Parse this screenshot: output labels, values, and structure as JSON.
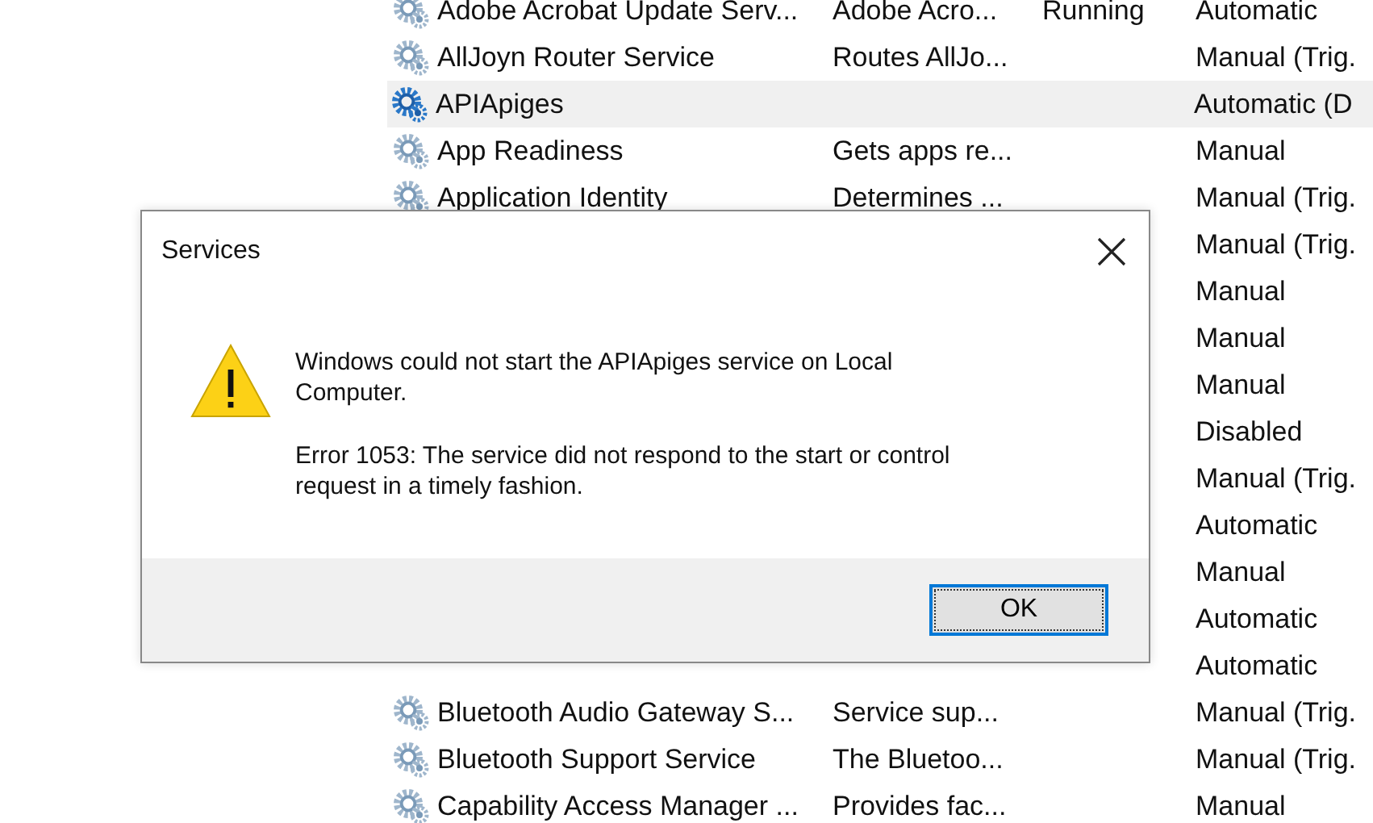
{
  "services": {
    "rows": [
      {
        "name": "Adobe Acrobat Update Serv...",
        "description": "Adobe Acro...",
        "status": "Running",
        "startup": "Automatic",
        "selected": false
      },
      {
        "name": "AllJoyn Router Service",
        "description": "Routes AllJo...",
        "startup": "Manual (Trig.",
        "selected": false
      },
      {
        "name": "APIApiges",
        "startup": "Automatic (D",
        "selected": true
      },
      {
        "name": "App Readiness",
        "description": "Gets apps re...",
        "startup": "Manual",
        "selected": false
      },
      {
        "name": "Application Identity",
        "description": "Determines ...",
        "startup": "Manual (Trig.",
        "selected": false
      },
      {
        "startup": "Manual (Trig.",
        "selected": false
      },
      {
        "startup": "Manual",
        "selected": false
      },
      {
        "startup": "Manual",
        "selected": false
      },
      {
        "startup": "Manual",
        "selected": false
      },
      {
        "startup": "Disabled",
        "selected": false
      },
      {
        "startup": "Manual (Trig.",
        "selected": false
      },
      {
        "startup": "Automatic",
        "selected": false
      },
      {
        "startup": "Manual",
        "selected": false
      },
      {
        "startup": "Automatic",
        "selected": false
      },
      {
        "startup": "Automatic",
        "selected": false
      },
      {
        "name": "Bluetooth Audio Gateway S...",
        "description": "Service sup...",
        "startup": "Manual (Trig.",
        "selected": false
      },
      {
        "name": "Bluetooth Support Service",
        "description": "The Bluetoo...",
        "startup": "Manual (Trig.",
        "selected": false
      },
      {
        "name": "Capability Access Manager ...",
        "description": "Provides fac...",
        "startup": "Manual",
        "selected": false
      }
    ]
  },
  "dialog": {
    "title": "Services",
    "message": "Windows could not start the APIApiges service on Local Computer.",
    "detail": "Error 1053: The service did not respond to the start or control request in a timely fashion.",
    "buttons": [
      "OK"
    ]
  }
}
